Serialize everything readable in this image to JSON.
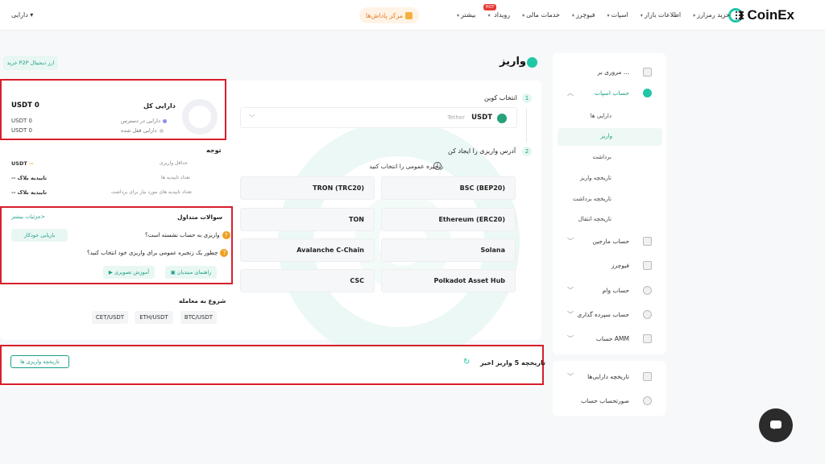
{
  "header": {
    "brand": "CoinEx",
    "nav": [
      {
        "label": "خرید رمزارز"
      },
      {
        "label": "اطلاعات بازار"
      },
      {
        "label": "اسپات"
      },
      {
        "label": "فیوچرز"
      },
      {
        "label": "خدمات مالی"
      },
      {
        "label": "رویداد",
        "badge": "HOT"
      },
      {
        "label": "بیشتر"
      }
    ],
    "reward_center": "مرکز پاداش‌ها",
    "assets_menu": "دارایی"
  },
  "sidebar": {
    "items": [
      {
        "label": "مروری بر ...",
        "icon": "overview-icon"
      },
      {
        "label": "حساب اسپات",
        "icon": "spot-account-icon",
        "expanded": true
      },
      {
        "label": "حساب مارجین",
        "icon": "margin-icon"
      },
      {
        "label": "فیوچرز",
        "icon": "futures-icon"
      },
      {
        "label": "حساب وام",
        "icon": "loan-icon"
      },
      {
        "label": "حساب سپرده گذاری",
        "icon": "deposit-account-icon"
      },
      {
        "label": "حساب AMM",
        "icon": "amm-icon"
      }
    ],
    "sub_items": [
      "دارایی ها",
      "واریز",
      "برداشت",
      "تاریخچه واریز",
      "تاریخچه برداشت",
      "تاریخچه انتقال"
    ],
    "active_sub": "واریز",
    "bottom_items": [
      {
        "label": "تاریخچه دارایی‌ها",
        "icon": "asset-history-icon"
      },
      {
        "label": "صورتحساب حساب",
        "icon": "statement-icon"
      }
    ]
  },
  "main": {
    "title": "واریز",
    "p2p_button": "خرید P2P ارز دیجیتال",
    "step1": {
      "num": "1",
      "label": "انتخاب کوین"
    },
    "coin": {
      "symbol": "USDT",
      "name": "Tether"
    },
    "step2": {
      "num": "2",
      "label": "آدرس واریزی را ایجاد کن"
    },
    "network_hint": "زنجیره عمومی را انتخاب کنید",
    "networks": [
      "BSC (BEP20)",
      "TRON (TRC20)",
      "Ethereum (ERC20)",
      "TON",
      "Solana",
      "Avalanche C-Chain",
      "Polkadot Asset Hub",
      "CSC"
    ]
  },
  "balance": {
    "title": "دارایی کل",
    "total": "USDT 0",
    "rows": [
      {
        "label": "دارایی در دسترس",
        "value": "USDT 0",
        "dot": "#8e8cf0"
      },
      {
        "label": "دارایی قفل شده",
        "value": "USDT 0",
        "dot": "#cfd3d8"
      }
    ]
  },
  "notes": {
    "title": "توجه",
    "rows": [
      {
        "label": "حداقل واریزی",
        "prefix": "USDT",
        "value": "--"
      },
      {
        "label": "تعداد تاییدیه ها",
        "prefix": "",
        "value": "-- تاییدیه بلاک"
      },
      {
        "label": "تعداد تاییدیه های مورد نیاز برای برداشت",
        "prefix": "",
        "value": "-- تاییدیه بلاک"
      }
    ]
  },
  "faq": {
    "title": "سوالات متداول",
    "more": "جزئیات بیشتر>",
    "auto_recover": "بازیابی خودکار",
    "questions": [
      "واریزی به حساب نشسته است؟",
      "چطور یک زنجیره عمومی برای واریزی خود انتخاب کنید؟"
    ],
    "guide": "راهنمای مبتدیان",
    "video": "آموزش تصویری"
  },
  "trade": {
    "title": "شروع به معامله",
    "pairs": [
      "BTC/USDT",
      "ETH/USDT",
      "CET/USDT"
    ]
  },
  "history": {
    "title": "تاریخچه 5 واریز اخیر",
    "button": "تاریخچه واریزی ها"
  },
  "colors": {
    "accent": "#1fc7a6",
    "highlight": "#d71f2b"
  }
}
